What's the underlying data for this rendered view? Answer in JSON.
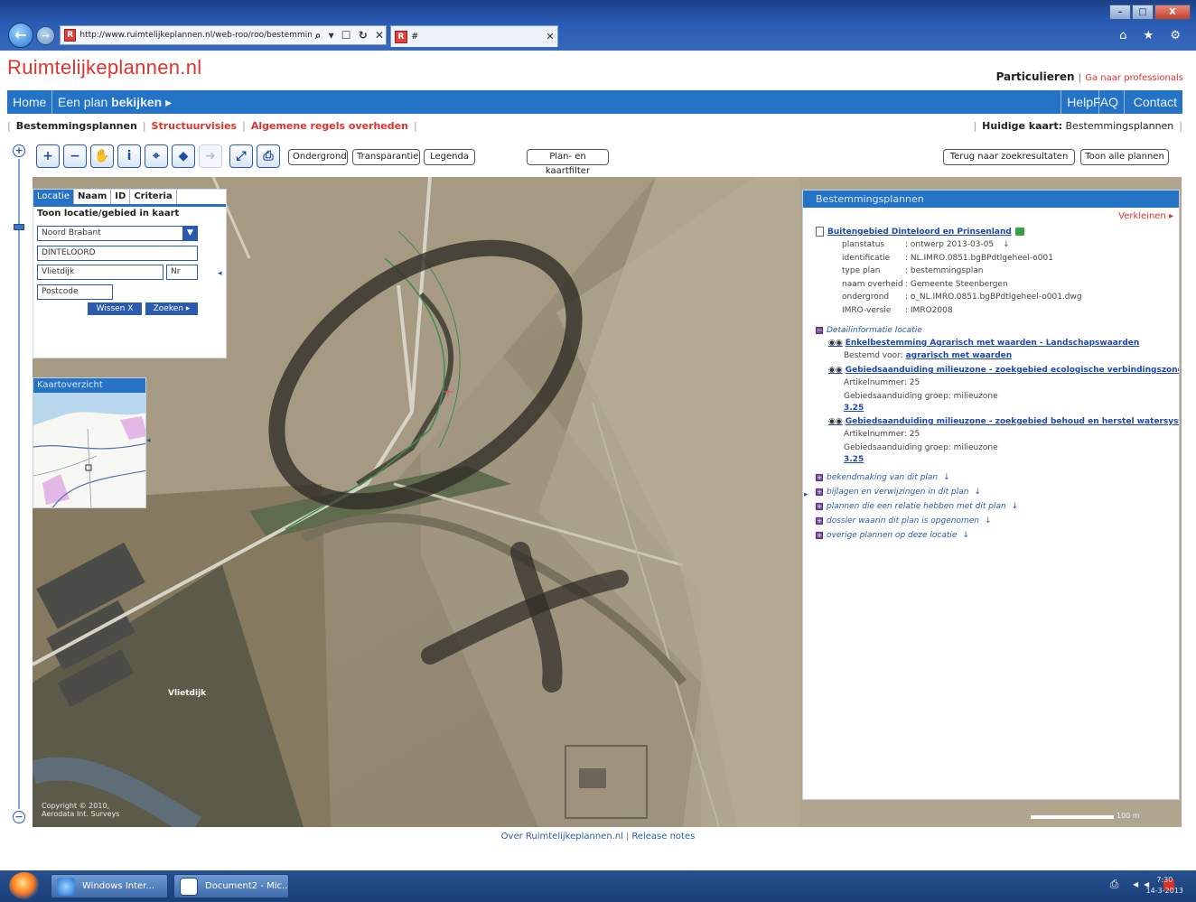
{
  "browser": {
    "url": "http://www.ruimtelijkeplannen.nl/web-roo/roo/bestemmings",
    "favicon": "R",
    "address_icons": "⌕ ▾ ☐ ↻ ✕",
    "tab_title": "#",
    "tab_close": "✕",
    "back_icon": "←",
    "forward_icon": "→",
    "window_buttons": [
      "–",
      "□",
      "X"
    ],
    "toolbar_icons": "⌂ ★ ⚙"
  },
  "site": {
    "logo": "Ruimtelijkeplannen.nl",
    "audience_active": "Particulieren",
    "audience_link": "Ga naar professionals"
  },
  "mainnav": {
    "home": "Home",
    "plan_prefix": "Een plan ",
    "plan_bold": "bekijken",
    "plan_arrow": "▸",
    "help": "Help",
    "faq": "FAQ",
    "contact": "Contact"
  },
  "subnav": {
    "items": [
      "Bestemmingsplannen",
      "Structuurvisies",
      "Algemene regels overheden"
    ],
    "current_map_label": "Huidige kaart:",
    "current_map_value": "Bestemmingsplannen"
  },
  "toolbar": {
    "tools": [
      {
        "name": "zoom-in-tool",
        "glyph": "+",
        "disabled": false
      },
      {
        "name": "zoom-out-tool",
        "glyph": "−",
        "disabled": false
      },
      {
        "name": "pan-tool",
        "glyph": "✋",
        "disabled": false
      },
      {
        "name": "info-tool",
        "glyph": "i",
        "disabled": false
      },
      {
        "name": "measure-tool",
        "glyph": "⌖",
        "disabled": false
      },
      {
        "name": "locate-tool",
        "glyph": "◆",
        "disabled": false
      },
      {
        "name": "forward-tool",
        "glyph": "➜",
        "disabled": true
      },
      {
        "name": "full-extent-tool",
        "glyph": "⤢",
        "disabled": false
      },
      {
        "name": "print-tool",
        "glyph": "⎙",
        "disabled": false
      }
    ],
    "ondergrond": "Ondergrond",
    "transparantie": "Transparantie",
    "legenda": "Legenda",
    "filter": "Plan- en kaartfilter",
    "back_results": "Terug naar zoekresultaten",
    "show_all": "Toon alle plannen",
    "zoom_in": "+",
    "zoom_out": "−"
  },
  "location_panel": {
    "tabs": [
      "Locatie",
      "Naam",
      "ID",
      "Criteria"
    ],
    "heading": "Toon locatie/gebied in kaart",
    "province": "Noord Brabant",
    "province_arrow": "▼",
    "place": "DINTELOORD",
    "street_placeholder": "Vlietdijk",
    "number_placeholder": "Nr",
    "postcode_placeholder": "Postcode",
    "clear_button": "Wissen  X",
    "search_button": "Zoeken  ▸",
    "collapse": "◂"
  },
  "overview": {
    "title": "Kaartoverzicht",
    "collapse": "◂"
  },
  "map": {
    "place_label": "Vlietdijk",
    "copyright_1": "Copyright © 2010,",
    "copyright_2": "Aerodata Int. Surveys",
    "scale_label": "100 m"
  },
  "info_panel": {
    "title": "Bestemmingsplannen",
    "shrink": "Verkleinen ▸",
    "plan_name": "Buitengebied Dinteloord en Prinsenland",
    "meta": [
      {
        "key": "planstatus",
        "value": ": ontwerp 2013-03-05",
        "download": "↓"
      },
      {
        "key": "identificatie",
        "value": ": NL.IMRO.0851.bgBPdtlgeheel-o001",
        "download": ""
      },
      {
        "key": "type plan",
        "value": ": bestemmingsplan",
        "download": ""
      },
      {
        "key": "naam overheid",
        "value": ": Gemeente Steenbergen",
        "download": ""
      },
      {
        "key": "ondergrond",
        "value": ": o_NL.IMRO.0851.bgBPdtlgeheel-o001.dwg",
        "download": ""
      },
      {
        "key": "IMRO-versie",
        "value": ": IMRO2008",
        "download": ""
      }
    ],
    "detail_heading": "Detailinformatie locatie",
    "detail_toggle": "−",
    "binoculars": "◉◉",
    "details": [
      {
        "title": "Enkelbestemming Agrarisch met waarden - Landschapswaarden",
        "sub_label": "Bestemd voor:",
        "sub_value": "agrarisch met waarden",
        "article": "",
        "group": "",
        "number": ""
      },
      {
        "title": "Gebiedsaanduiding milieuzone - zoekgebied ecologische verbindingszone",
        "sub_label": "",
        "sub_value": "",
        "article": "Artikelnummer: 25",
        "group": "Gebiedsaanduiding groep: milieuzone",
        "number": "3.25"
      },
      {
        "title": "Gebiedsaanduiding milieuzone - zoekgebied behoud en herstel watersysteem",
        "sub_label": "",
        "sub_value": "",
        "article": "Artikelnummer: 25",
        "group": "Gebiedsaanduiding groep: milieuzone",
        "number": "3.25"
      }
    ],
    "sections": [
      {
        "label": "bekendmaking van dit plan",
        "download": "↓"
      },
      {
        "label": "bijlagen en verwijzingen in dit plan",
        "download": "↓"
      },
      {
        "label": "plannen die een relatie hebben met dit plan",
        "download": "↓"
      },
      {
        "label": "dossier waarin dit plan is opgenomen",
        "download": "↓"
      },
      {
        "label": "overige plannen op deze locatie",
        "download": "↓"
      }
    ],
    "section_toggle": "+",
    "collapse": "▸"
  },
  "footer": {
    "about": "Over Ruimtelijkeplannen.nl",
    "release": "Release notes"
  },
  "taskbar": {
    "ie_label": "Windows Inter...",
    "word_label": "Document2 - Mic...",
    "tray": "⎙ ◂◂",
    "clock_time": "7:30",
    "clock_date": "14-3-2013"
  }
}
